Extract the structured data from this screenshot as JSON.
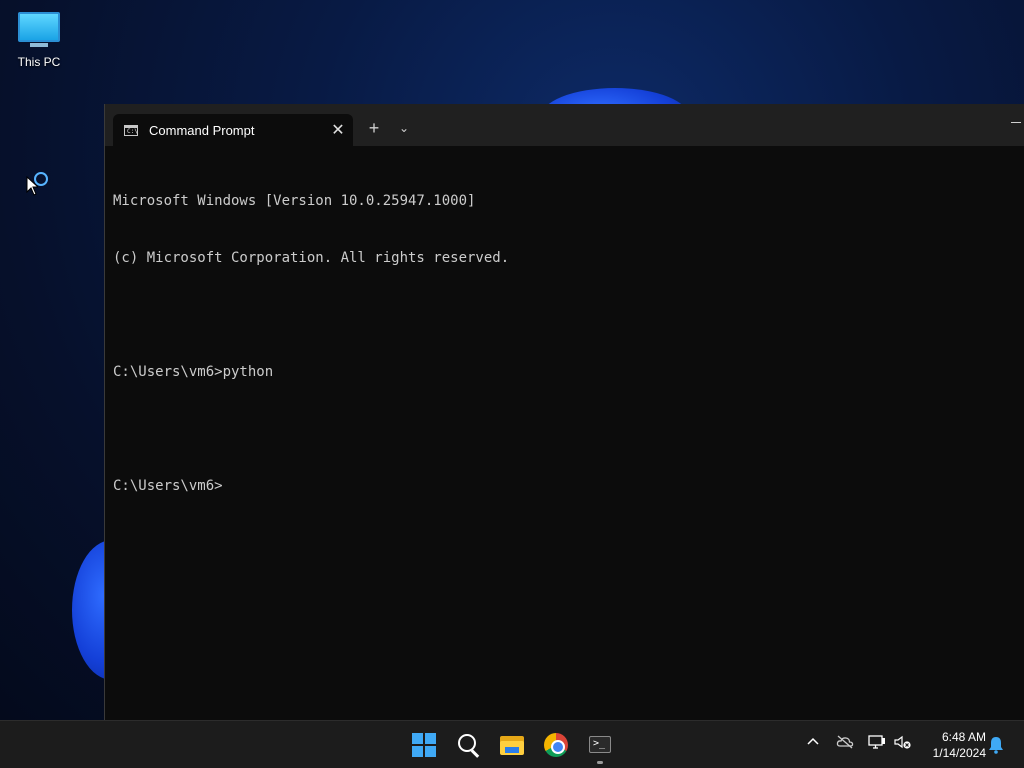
{
  "desktop": {
    "icons": [
      {
        "label": "This PC",
        "icon": "computer-icon"
      }
    ]
  },
  "terminal": {
    "tab_title": "Command Prompt",
    "tab_icon": "cmd-icon",
    "lines": [
      "Microsoft Windows [Version 10.0.25947.1000]",
      "(c) Microsoft Corporation. All rights reserved.",
      "",
      "C:\\Users\\vm6>python",
      "",
      "C:\\Users\\vm6>"
    ],
    "colors": {
      "background": "#0c0c0c",
      "text": "#cccccc",
      "titlebar": "#202020"
    }
  },
  "taskbar": {
    "apps": [
      "start-icon",
      "search-icon",
      "file-explorer-icon",
      "chrome-icon",
      "terminal-icon"
    ],
    "tray_icons": [
      "chevron-up-icon",
      "onedrive-offline-icon",
      "network-icon",
      "volume-muted-icon",
      "bell-icon"
    ],
    "clock": {
      "time": "6:48 AM",
      "date": "1/14/2024"
    },
    "accent": "#3fa9f5"
  }
}
